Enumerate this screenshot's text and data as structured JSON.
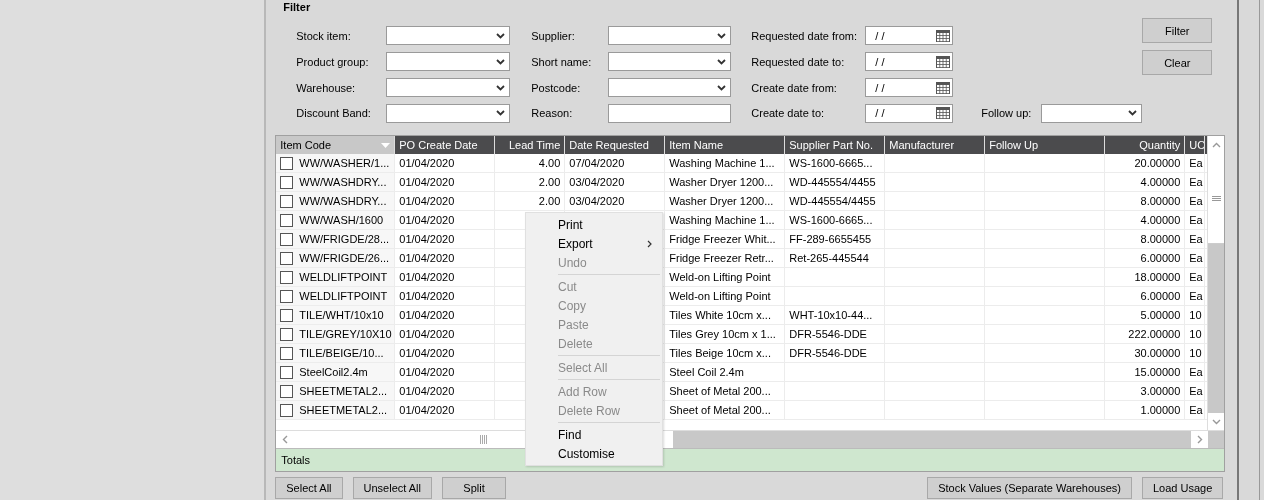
{
  "filter": {
    "title": "Filter",
    "rows": [
      [
        {
          "label": "Stock item:",
          "kind": "combo"
        },
        {
          "label": "Supplier:",
          "kind": "combo"
        },
        {
          "label": "Requested date from:",
          "kind": "date",
          "value": "/ /"
        }
      ],
      [
        {
          "label": "Product group:",
          "kind": "combo"
        },
        {
          "label": "Short name:",
          "kind": "combo"
        },
        {
          "label": "Requested date to:",
          "kind": "date",
          "value": "/ /"
        }
      ],
      [
        {
          "label": "Warehouse:",
          "kind": "combo"
        },
        {
          "label": "Postcode:",
          "kind": "combo"
        },
        {
          "label": "Create date from:",
          "kind": "date",
          "value": "/ /"
        }
      ],
      [
        {
          "label": "Discount Band:",
          "kind": "combo"
        },
        {
          "label": "Reason:",
          "kind": "text"
        },
        {
          "label": "Create date to:",
          "kind": "date",
          "value": "/ /"
        },
        {
          "label": "Follow up:",
          "kind": "combo"
        }
      ]
    ],
    "buttons": [
      "Filter",
      "Clear"
    ]
  },
  "grid": {
    "columns": [
      {
        "label": "Item Code",
        "selected": true
      },
      {
        "label": "PO Create Date",
        "selected": false
      },
      {
        "label": "Lead Time",
        "selected": false
      },
      {
        "label": "Date Requested",
        "selected": false
      },
      {
        "label": "Item Name",
        "selected": false
      },
      {
        "label": "Supplier Part No.",
        "selected": false
      },
      {
        "label": "Manufacturer",
        "selected": false
      },
      {
        "label": "Follow Up",
        "selected": false
      },
      {
        "label": "Quantity",
        "selected": false
      },
      {
        "label": "UO",
        "selected": false
      }
    ],
    "rows": [
      {
        "checked": false,
        "item_code": "WW/WASHER/1...",
        "po_create_date": "01/04/2020",
        "lead_time": "4.00",
        "date_requested": "07/04/2020",
        "item_name": "Washing Machine 1...",
        "supplier_part_no": "WS-1600-6665...",
        "quantity": "20.00000",
        "uom": "Ea"
      },
      {
        "checked": false,
        "item_code": "WW/WASHDRY...",
        "po_create_date": "01/04/2020",
        "lead_time": "2.00",
        "date_requested": "03/04/2020",
        "item_name": "Washer Dryer 1200...",
        "supplier_part_no": "WD-445554/4455",
        "quantity": "4.00000",
        "uom": "Ea"
      },
      {
        "checked": false,
        "item_code": "WW/WASHDRY...",
        "po_create_date": "01/04/2020",
        "lead_time": "2.00",
        "date_requested": "03/04/2020",
        "item_name": "Washer Dryer 1200...",
        "supplier_part_no": "WD-445554/4455",
        "quantity": "8.00000",
        "uom": "Ea"
      },
      {
        "checked": false,
        "item_code": "WW/WASH/1600",
        "po_create_date": "01/04/2020",
        "item_name": "Washing Machine 1...",
        "supplier_part_no": "WS-1600-6665...",
        "quantity": "4.00000",
        "uom": "Ea"
      },
      {
        "checked": false,
        "item_code": "WW/FRIGDE/28...",
        "po_create_date": "01/04/2020",
        "item_name": "Fridge Freezer Whit...",
        "supplier_part_no": "FF-289-6655455",
        "quantity": "8.00000",
        "uom": "Ea"
      },
      {
        "checked": false,
        "item_code": "WW/FRIGDE/26...",
        "po_create_date": "01/04/2020",
        "item_name": "Fridge Freezer Retr...",
        "supplier_part_no": "Ret-265-445544",
        "quantity": "6.00000",
        "uom": "Ea"
      },
      {
        "checked": false,
        "item_code": "WELDLIFTPOINT",
        "po_create_date": "01/04/2020",
        "item_name": "Weld-on Lifting Point",
        "quantity": "18.00000",
        "uom": "Ea"
      },
      {
        "checked": false,
        "item_code": "WELDLIFTPOINT",
        "po_create_date": "01/04/2020",
        "item_name": "Weld-on Lifting Point",
        "quantity": "6.00000",
        "uom": "Ea"
      },
      {
        "checked": false,
        "item_code": "TILE/WHT/10x10",
        "po_create_date": "01/04/2020",
        "item_name": "Tiles White 10cm x...",
        "supplier_part_no": "WHT-10x10-44...",
        "quantity": "5.00000",
        "uom": "10"
      },
      {
        "checked": false,
        "item_code": "TILE/GREY/10X10",
        "po_create_date": "01/04/2020",
        "item_name": "Tiles Grey 10cm x 1...",
        "supplier_part_no": "DFR-5546-DDE",
        "quantity": "222.00000",
        "uom": "10"
      },
      {
        "checked": false,
        "item_code": "TILE/BEIGE/10...",
        "po_create_date": "01/04/2020",
        "item_name": "Tiles Beige 10cm x...",
        "supplier_part_no": "DFR-5546-DDE",
        "quantity": "30.00000",
        "uom": "10"
      },
      {
        "checked": false,
        "item_code": "SteelCoil2.4m",
        "po_create_date": "01/04/2020",
        "item_name": "Steel Coil 2.4m",
        "quantity": "15.00000",
        "uom": "Ea"
      },
      {
        "checked": false,
        "item_code": "SHEETMETAL2...",
        "po_create_date": "01/04/2020",
        "item_name": "Sheet of Metal 200...",
        "quantity": "3.00000",
        "uom": "Ea"
      },
      {
        "checked": false,
        "item_code": "SHEETMETAL2...",
        "po_create_date": "01/04/2020",
        "item_name": "Sheet of Metal 200...",
        "quantity": "1.00000",
        "uom": "Ea"
      }
    ],
    "totals_label": "Totals"
  },
  "context_menu": [
    {
      "kind": "item",
      "label": "Print",
      "disabled": false,
      "submenu": false
    },
    {
      "kind": "item",
      "label": "Export",
      "disabled": false,
      "submenu": true
    },
    {
      "kind": "item",
      "label": "Undo",
      "disabled": true,
      "submenu": false
    },
    {
      "kind": "separator"
    },
    {
      "kind": "item",
      "label": "Cut",
      "disabled": true,
      "submenu": false
    },
    {
      "kind": "item",
      "label": "Copy",
      "disabled": true,
      "submenu": false
    },
    {
      "kind": "item",
      "label": "Paste",
      "disabled": true,
      "submenu": false
    },
    {
      "kind": "item",
      "label": "Delete",
      "disabled": true,
      "submenu": false
    },
    {
      "kind": "separator"
    },
    {
      "kind": "item",
      "label": "Select All",
      "disabled": true,
      "submenu": false
    },
    {
      "kind": "separator"
    },
    {
      "kind": "item",
      "label": "Add Row",
      "disabled": true,
      "submenu": false
    },
    {
      "kind": "item",
      "label": "Delete Row",
      "disabled": true,
      "submenu": false
    },
    {
      "kind": "separator"
    },
    {
      "kind": "item",
      "label": "Find",
      "disabled": false,
      "submenu": false
    },
    {
      "kind": "item",
      "label": "Customise",
      "disabled": false,
      "submenu": false
    }
  ],
  "bottom_buttons": {
    "left": [
      "Select All",
      "Unselect All",
      "Split"
    ],
    "right": [
      "Stock Values (Separate Warehouses)",
      "Load Usage"
    ]
  }
}
